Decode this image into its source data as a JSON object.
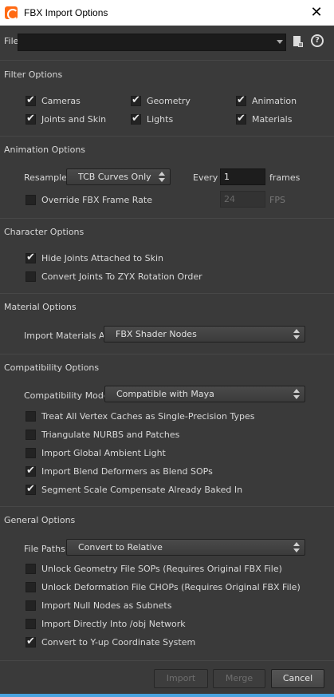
{
  "window": {
    "title": "FBX Import Options",
    "close_glyph": "✕",
    "icon": "houdini-icon"
  },
  "file": {
    "label": "File",
    "value": "",
    "icon_browse": "file-browse-icon",
    "icon_help": "help-icon",
    "help_glyph": "?"
  },
  "filter": {
    "title": "Filter Options",
    "items": [
      {
        "label": "Cameras",
        "checked": true
      },
      {
        "label": "Geometry",
        "checked": true
      },
      {
        "label": "Animation",
        "checked": true
      },
      {
        "label": "Joints and Skin",
        "checked": true
      },
      {
        "label": "Lights",
        "checked": true
      },
      {
        "label": "Materials",
        "checked": true
      }
    ]
  },
  "animation": {
    "title": "Animation Options",
    "resample_label": "Resample",
    "resample_value": "TCB Curves Only",
    "every_label": "Every",
    "every_value": "1",
    "frames_label": "frames",
    "override_label": "Override FBX Frame Rate",
    "override_checked": false,
    "fps_value": "24",
    "fps_label": "FPS"
  },
  "character": {
    "title": "Character Options",
    "items": [
      {
        "label": "Hide Joints Attached to Skin",
        "checked": true
      },
      {
        "label": "Convert Joints To ZYX Rotation Order",
        "checked": false
      }
    ]
  },
  "material": {
    "title": "Material Options",
    "import_label": "Import Materials As",
    "import_value": "FBX Shader Nodes"
  },
  "compat": {
    "title": "Compatibility Options",
    "mode_label": "Compatibility Mode",
    "mode_value": "Compatible with Maya",
    "items": [
      {
        "label": "Treat All Vertex Caches as Single-Precision Types",
        "checked": false
      },
      {
        "label": "Triangulate NURBS and Patches",
        "checked": false
      },
      {
        "label": "Import Global Ambient Light",
        "checked": false
      },
      {
        "label": "Import Blend Deformers as Blend SOPs",
        "checked": true
      },
      {
        "label": "Segment Scale Compensate Already Baked In",
        "checked": true
      }
    ]
  },
  "general": {
    "title": "General Options",
    "paths_label": "File Paths",
    "paths_value": "Convert to Relative",
    "items": [
      {
        "label": "Unlock Geometry File SOPs (Requires Original FBX File)",
        "checked": false
      },
      {
        "label": "Unlock Deformation File CHOPs (Requires Original FBX File)",
        "checked": false
      },
      {
        "label": "Import Null Nodes as Subnets",
        "checked": false
      },
      {
        "label": "Import Directly Into /obj Network",
        "checked": false
      },
      {
        "label": "Convert to Y-up Coordinate System",
        "checked": true
      }
    ]
  },
  "buttons": {
    "import": "Import",
    "merge": "Merge",
    "cancel": "Cancel"
  },
  "colors": {
    "background": "#3a3a3a",
    "titlebar": "#ffffff",
    "accent": "#4aa3df",
    "houdini_orange": "#ff6a13"
  }
}
